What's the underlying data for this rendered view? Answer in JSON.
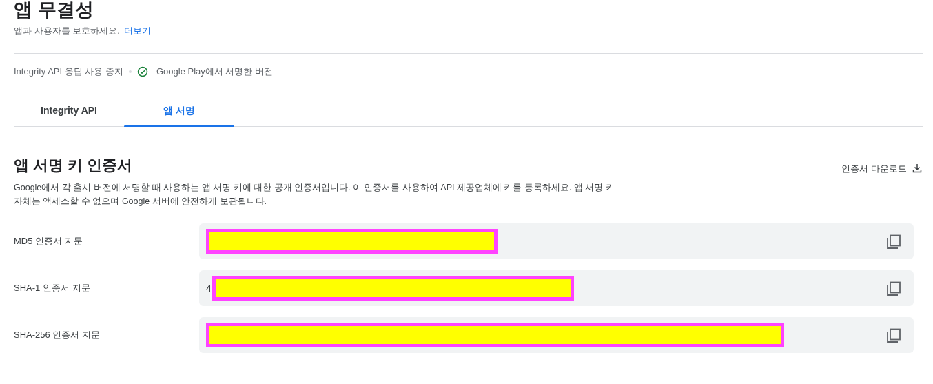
{
  "page": {
    "title": "앱 무결성",
    "subtitle": "앱과 사용자를 보호하세요.",
    "more_link": "더보기"
  },
  "status": {
    "item_1": "Integrity API 응답 사용 중지",
    "item_2": "Google Play에서 서명한 버전"
  },
  "tabs": [
    {
      "label": "Integrity API",
      "selected": false
    },
    {
      "label": "앱 서명",
      "selected": true
    }
  ],
  "section": {
    "title": "앱 서명 키 인증서",
    "download": "인증서 다운로드",
    "description": "Google에서 각 출시 버전에 서명할 때 사용하는 앱 서명 키에 대한 공개 인증서입니다. 이 인증서를 사용하여 API 제공업체에 키를 등록하세요. 앱 서명 키 자체는 액세스할 수 없으며 Google 서버에 안전하게 보관됩니다."
  },
  "fingerprints": [
    {
      "label": "MD5 인증서 지문",
      "redacted": true
    },
    {
      "label": "SHA-1 인증서 지문",
      "value": "4",
      "redacted": true
    },
    {
      "label": "SHA-256 인증서 지문",
      "redacted": true
    }
  ]
}
